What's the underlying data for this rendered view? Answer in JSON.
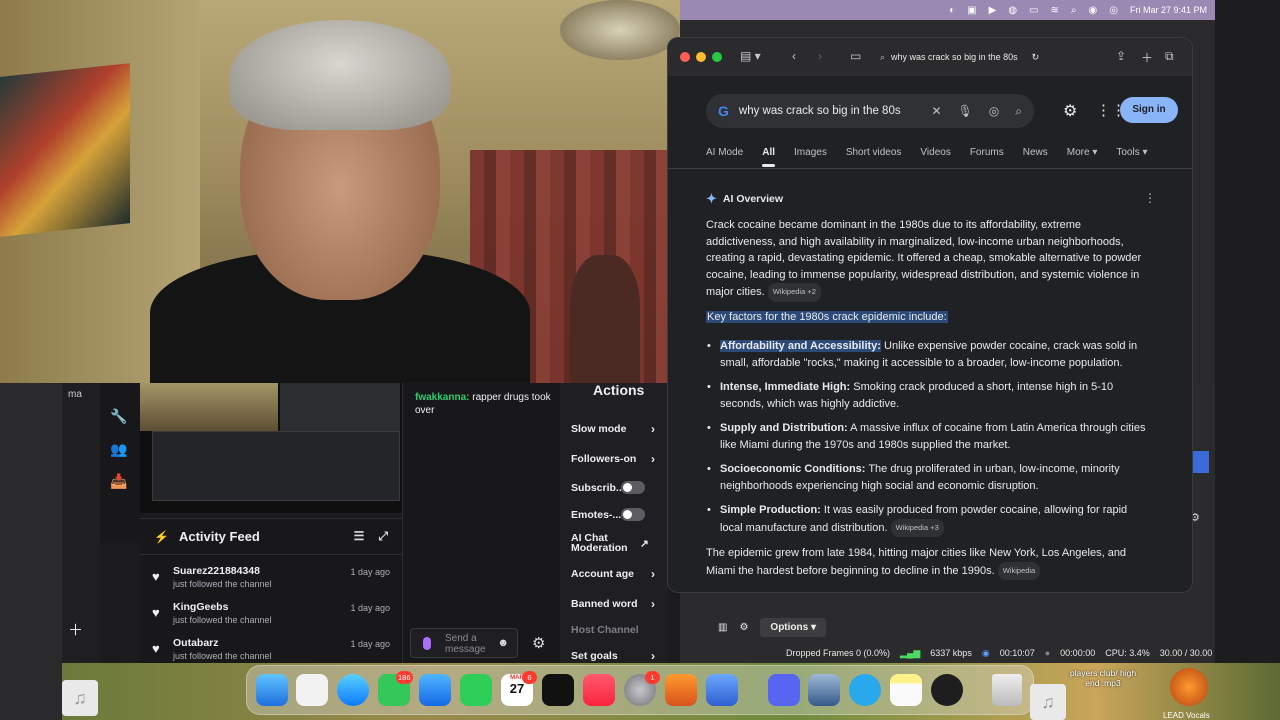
{
  "menubar": {
    "datetime": "Fri Mar 27  9:41 PM"
  },
  "browser": {
    "address_text": "why was crack so big in the 80s",
    "search_query": "why was crack so big in the 80s",
    "sign_in_label": "Sign in",
    "tabs": [
      "AI Mode",
      "All",
      "Images",
      "Short videos",
      "Videos",
      "Forums",
      "News",
      "More",
      "Tools"
    ],
    "ai_overview_label": "AI Overview",
    "intro": "Crack cocaine became dominant in the 1980s due to its affordability, extreme addictiveness, and high availability in marginalized, low-income urban neighborhoods, creating a rapid, devastating epidemic. It offered a cheap, smokable alternative to powder cocaine, leading to immense popularity, widespread distribution, and systemic violence in major cities.",
    "intro_cite": "Wikipedia +2",
    "key_factors_heading": "Key factors for the 1980s crack epidemic include:",
    "bullets": [
      {
        "title": "Affordability and Accessibility:",
        "text": "Unlike expensive powder cocaine, crack was sold in small, affordable \"rocks,\" making it accessible to a broader, low-income population."
      },
      {
        "title": "Intense, Immediate High:",
        "text": "Smoking crack produced a short, intense high in 5-10 seconds, which was highly addictive."
      },
      {
        "title": "Supply and Distribution:",
        "text": "A massive influx of cocaine from Latin America through cities like Miami during the 1970s and 1980s supplied the market."
      },
      {
        "title": "Socioeconomic Conditions:",
        "text": "The drug proliferated in urban, low-income, minority neighborhoods experiencing high social and economic disruption."
      },
      {
        "title": "Simple Production:",
        "text": "It was easily produced from powder cocaine, allowing for rapid local manufacture and distribution."
      }
    ],
    "bullet5_cite": "Wikipedia +3",
    "outro": "The epidemic grew from late 1984, hitting major cities like New York, Los Angeles, and Miami the hardest before beginning to decline in the 1990s.",
    "outro_cite": "Wikipedia"
  },
  "stream": {
    "activity_title": "Activity Feed",
    "follows": [
      {
        "name": "Suarez221884348",
        "action": "just followed the channel",
        "time": "1 day ago"
      },
      {
        "name": "KingGeebs",
        "action": "just followed the channel",
        "time": "1 day ago"
      },
      {
        "name": "Outabarz",
        "action": "just followed the channel",
        "time": "1 day ago"
      }
    ],
    "chat": {
      "user": "fwakkanna:",
      "message": "rapper drugs took over"
    },
    "chat_placeholder": "Send a message",
    "actions_title": "Actions",
    "actions": [
      "Slow mode",
      "Followers-on",
      "Subscrib...",
      "Emotes-...",
      "AI Chat Moderation",
      "Account age",
      "Banned word",
      "Host Channel",
      "Set goals"
    ],
    "left_label": "ma"
  },
  "obs": {
    "options_label": "Options",
    "dropped_frames": "Dropped Frames 0 (0.0%)",
    "bitrate": "6337 kbps",
    "rec_time": "00:10:07",
    "stream_time": "00:00:00",
    "cpu": "CPU: 3.4%",
    "fps": "30.00 / 30.00 FPS"
  },
  "dock": {
    "messages_badge": "186",
    "calendar_badge": "6",
    "calendar_day": "27",
    "calendar_month": "MAR",
    "settings_badge": "1",
    "track_label": "players club/ high end .mp3",
    "lead_label": "LEAD Vocals"
  },
  "colors": {
    "accent": "#8ab4f8",
    "highlight": "#2c4a78",
    "twitch_purple": "#a970ff"
  }
}
